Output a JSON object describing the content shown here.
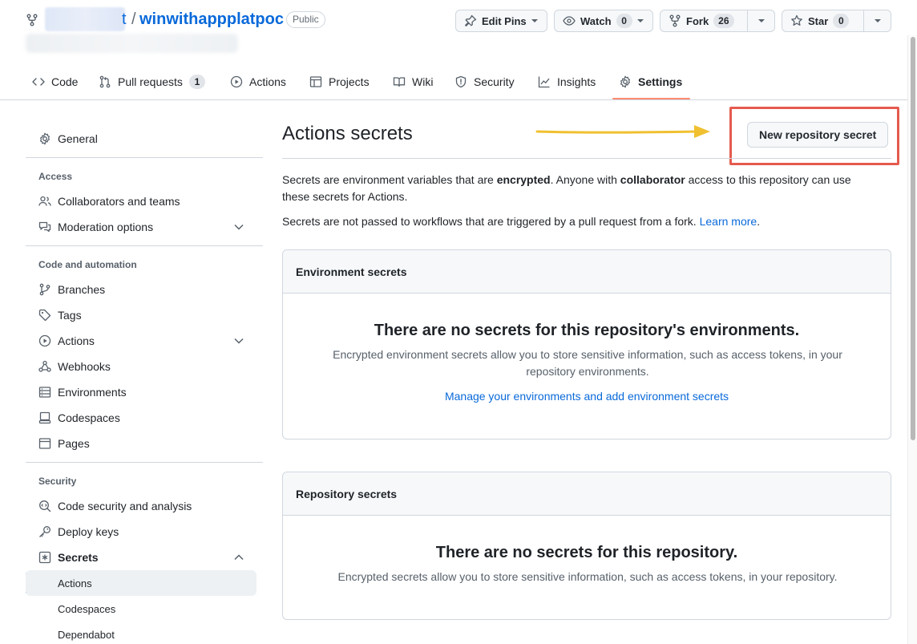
{
  "header": {
    "owner_suffix": "t",
    "separator": "/",
    "repo_name": "winwithappplatpoc",
    "visibility": "Public",
    "actions": {
      "edit_pins": "Edit Pins",
      "watch": "Watch",
      "watch_count": "0",
      "fork": "Fork",
      "fork_count": "26",
      "star": "Star",
      "star_count": "0"
    }
  },
  "tabs": [
    {
      "label": "Code",
      "icon": "code-icon"
    },
    {
      "label": "Pull requests",
      "icon": "pull-request-icon",
      "count": "1"
    },
    {
      "label": "Actions",
      "icon": "play-icon"
    },
    {
      "label": "Projects",
      "icon": "table-icon"
    },
    {
      "label": "Wiki",
      "icon": "book-icon"
    },
    {
      "label": "Security",
      "icon": "shield-icon"
    },
    {
      "label": "Insights",
      "icon": "graph-icon"
    },
    {
      "label": "Settings",
      "icon": "gear-icon",
      "selected": true
    }
  ],
  "sidebar": {
    "general": "General",
    "access_heading": "Access",
    "collaborators": "Collaborators and teams",
    "moderation": "Moderation options",
    "code_automation_heading": "Code and automation",
    "branches": "Branches",
    "tags": "Tags",
    "actions": "Actions",
    "webhooks": "Webhooks",
    "environments": "Environments",
    "codespaces": "Codespaces",
    "pages": "Pages",
    "security_heading": "Security",
    "code_security": "Code security and analysis",
    "deploy_keys": "Deploy keys",
    "secrets": "Secrets",
    "secrets_sub": [
      "Actions",
      "Codespaces",
      "Dependabot"
    ]
  },
  "main": {
    "title": "Actions secrets",
    "new_secret_button": "New repository secret",
    "intro": {
      "p1_a": "Secrets are environment variables that are ",
      "p1_b": "encrypted",
      "p1_c": ". Anyone with ",
      "p1_d": "collaborator",
      "p1_e": " access to this repository can use",
      "p1_f": "these secrets for Actions.",
      "p2": "Secrets are not passed to workflows that are triggered by a pull request from a fork.",
      "learn_more": "Learn more",
      "period": "."
    },
    "env_box": {
      "heading": "Environment secrets",
      "blank_title": "There are no secrets for this repository's environments.",
      "blank_line1": "Encrypted environment secrets allow you to store sensitive information, such as access tokens, in your",
      "blank_line2": "repository environments.",
      "link": "Manage your environments and add environment secrets"
    },
    "repo_box": {
      "heading": "Repository secrets",
      "blank_title": "There are no secrets for this repository.",
      "blank_text": "Encrypted secrets allow you to store sensitive information, such as access tokens, in your repository."
    }
  },
  "colors": {
    "link": "#0969da",
    "highlight": "#e55b4f",
    "arrow": "#f0c030",
    "tab_underline": "#fd8c73"
  }
}
